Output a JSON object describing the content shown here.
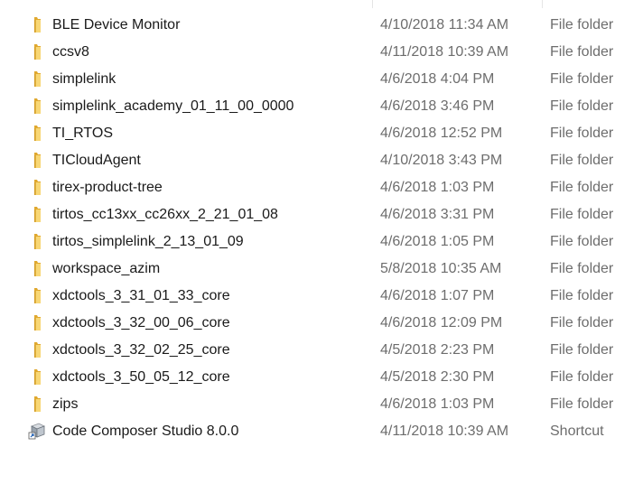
{
  "files": [
    {
      "name": "BLE Device Monitor",
      "date_modified": "4/10/2018 11:34 AM",
      "type": "File folder",
      "icon": "folder-icon"
    },
    {
      "name": "ccsv8",
      "date_modified": "4/11/2018 10:39 AM",
      "type": "File folder",
      "icon": "folder-icon"
    },
    {
      "name": "simplelink",
      "date_modified": "4/6/2018 4:04 PM",
      "type": "File folder",
      "icon": "folder-icon"
    },
    {
      "name": "simplelink_academy_01_11_00_0000",
      "date_modified": "4/6/2018 3:46 PM",
      "type": "File folder",
      "icon": "folder-icon"
    },
    {
      "name": "TI_RTOS",
      "date_modified": "4/6/2018 12:52 PM",
      "type": "File folder",
      "icon": "folder-icon"
    },
    {
      "name": "TICloudAgent",
      "date_modified": "4/10/2018 3:43 PM",
      "type": "File folder",
      "icon": "folder-icon"
    },
    {
      "name": "tirex-product-tree",
      "date_modified": "4/6/2018 1:03 PM",
      "type": "File folder",
      "icon": "folder-icon"
    },
    {
      "name": "tirtos_cc13xx_cc26xx_2_21_01_08",
      "date_modified": "4/6/2018 3:31 PM",
      "type": "File folder",
      "icon": "folder-icon"
    },
    {
      "name": "tirtos_simplelink_2_13_01_09",
      "date_modified": "4/6/2018 1:05 PM",
      "type": "File folder",
      "icon": "folder-icon"
    },
    {
      "name": "workspace_azim",
      "date_modified": "5/8/2018 10:35 AM",
      "type": "File folder",
      "icon": "folder-icon"
    },
    {
      "name": "xdctools_3_31_01_33_core",
      "date_modified": "4/6/2018 1:07 PM",
      "type": "File folder",
      "icon": "folder-icon"
    },
    {
      "name": "xdctools_3_32_00_06_core",
      "date_modified": "4/6/2018 12:09 PM",
      "type": "File folder",
      "icon": "folder-icon"
    },
    {
      "name": "xdctools_3_32_02_25_core",
      "date_modified": "4/5/2018 2:23 PM",
      "type": "File folder",
      "icon": "folder-icon"
    },
    {
      "name": "xdctools_3_50_05_12_core",
      "date_modified": "4/5/2018 2:30 PM",
      "type": "File folder",
      "icon": "folder-icon"
    },
    {
      "name": "zips",
      "date_modified": "4/6/2018 1:03 PM",
      "type": "File folder",
      "icon": "folder-icon"
    },
    {
      "name": "Code Composer Studio 8.0.0",
      "date_modified": "4/11/2018 10:39 AM",
      "type": "Shortcut",
      "icon": "shortcut-app-icon"
    }
  ],
  "colors": {
    "folder_back": "#e0a82e",
    "folder_front": "#f8d775",
    "secondary_text": "#6d6d6d",
    "primary_text": "#1a1a1a"
  }
}
